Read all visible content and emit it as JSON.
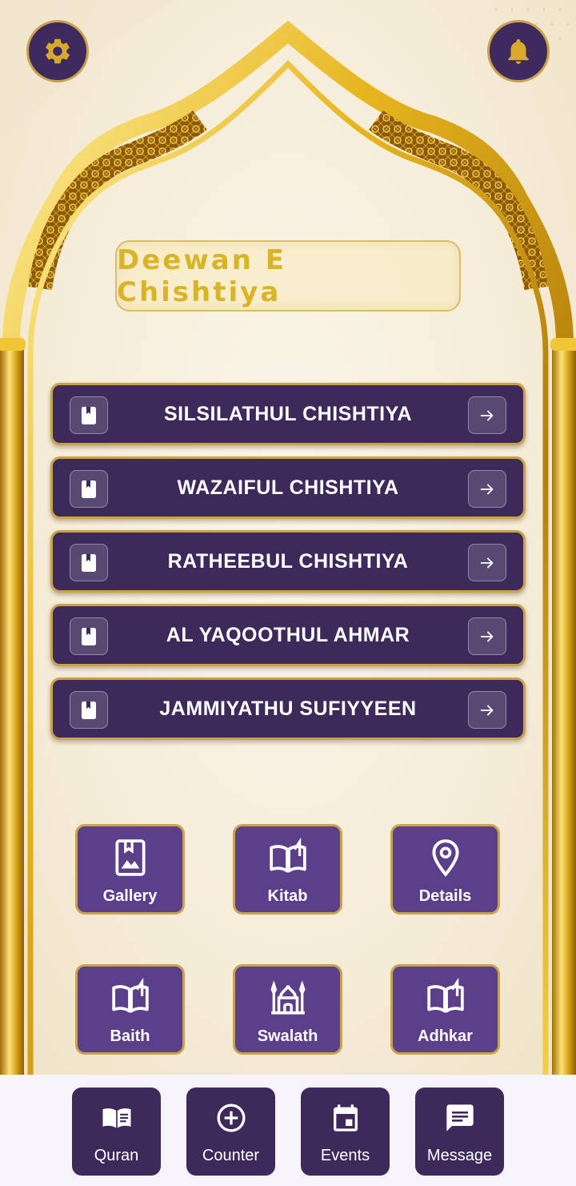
{
  "app": {
    "title": "Deewan E Chishtiya"
  },
  "header": {
    "settings_icon": "gear-icon",
    "notifications_icon": "bell-icon"
  },
  "menu": {
    "items": [
      {
        "label": "SILSILATHUL CHISHTIYA",
        "icon": "book-icon",
        "trail_icon": "arrow-right-icon"
      },
      {
        "label": "WAZAIFUL CHISHTIYA",
        "icon": "book-icon",
        "trail_icon": "arrow-right-icon"
      },
      {
        "label": "RATHEEBUL CHISHTIYA",
        "icon": "book-icon",
        "trail_icon": "arrow-right-icon"
      },
      {
        "label": "AL YAQOOTHUL AHMAR",
        "icon": "book-icon",
        "trail_icon": "arrow-right-icon"
      },
      {
        "label": "JAMMIYATHU SUFIYYEEN",
        "icon": "book-icon",
        "trail_icon": "arrow-right-icon"
      }
    ]
  },
  "tiles": [
    {
      "label": "Gallery",
      "icon": "photo-album-icon"
    },
    {
      "label": "Kitab",
      "icon": "open-book-icon"
    },
    {
      "label": "Details",
      "icon": "location-pin-icon"
    },
    {
      "label": "Baith",
      "icon": "open-book-icon"
    },
    {
      "label": "Swalath",
      "icon": "mosque-icon"
    },
    {
      "label": "Adhkar",
      "icon": "open-book-icon"
    }
  ],
  "bottom_nav": [
    {
      "label": "Quran",
      "icon": "quran-book-icon"
    },
    {
      "label": "Counter",
      "icon": "plus-circle-icon"
    },
    {
      "label": "Events",
      "icon": "calendar-icon"
    },
    {
      "label": "Message",
      "icon": "message-icon"
    }
  ],
  "colors": {
    "primary": "#3d2a5a",
    "tile": "#5b3f8a",
    "gold": "#c9a24a",
    "title_text": "#d9b426",
    "background": "#f6eede"
  }
}
